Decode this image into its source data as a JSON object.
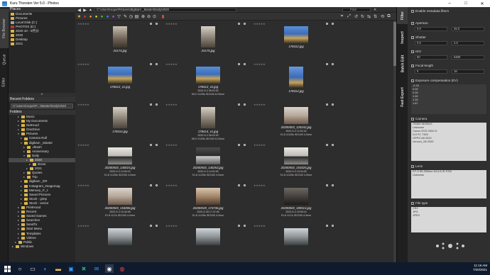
{
  "window": {
    "title": "Kuru Thorsten Ver 5.0 - Photos"
  },
  "left_tabs": [
    "File Browser",
    "Queue",
    "Editor"
  ],
  "places": {
    "header": "Places",
    "items": [
      {
        "label": "Documents",
        "icon": "folder"
      },
      {
        "label": "Pictures",
        "icon": "folder"
      },
      {
        "label": "Local Disk (C:)",
        "icon": "drive"
      },
      {
        "label": "PHOTOS (D:)",
        "icon": "drive-red"
      },
      {
        "label": "2020-10 - 9月分",
        "icon": "folder"
      },
      {
        "label": "2020",
        "icon": "folder"
      },
      {
        "label": "Desktop",
        "icon": "folder"
      },
      {
        "label": "2021",
        "icon": "folder"
      }
    ]
  },
  "recent_folders": {
    "header": "Recent Folders",
    "path": "C:\\Users\\reque\\Pi...\\Master\\Daily\\2020"
  },
  "folders": {
    "header": "Folders",
    "tree": [
      {
        "label": "Music",
        "indent": 3
      },
      {
        "label": "My Documents",
        "indent": 3
      },
      {
        "label": "NetHood",
        "indent": 3
      },
      {
        "label": "OneDrive",
        "indent": 3
      },
      {
        "label": "Pictures",
        "indent": 3,
        "expanded": true
      },
      {
        "label": "Camera Roll",
        "indent": 4
      },
      {
        "label": "digikam _Master",
        "indent": 4,
        "expanded": true
      },
      {
        "label": ".dtrash",
        "indent": 5
      },
      {
        "label": "Anniversary",
        "indent": 5
      },
      {
        "label": "Daily",
        "indent": 5,
        "expanded": true
      },
      {
        "label": "2020",
        "indent": 6,
        "selected": true
      },
      {
        "label": "drone",
        "indent": 7
      },
      {
        "label": "2021",
        "indent": 6
      },
      {
        "label": "Quotes",
        "indent": 5
      },
      {
        "label": "Trip",
        "indent": 5
      },
      {
        "label": "digikam _ER",
        "indent": 4
      },
      {
        "label": "Instagram_imagemag",
        "indent": 4
      },
      {
        "label": "Memory_P_J",
        "indent": 4
      },
      {
        "label": "Saved Pictures",
        "indent": 4
      },
      {
        "label": "Stock - gimp",
        "indent": 4
      },
      {
        "label": "Stock - vector",
        "indent": 4
      },
      {
        "label": "PrintHood",
        "indent": 3
      },
      {
        "label": "Recent",
        "indent": 3
      },
      {
        "label": "Saved Games",
        "indent": 3
      },
      {
        "label": "Searches",
        "indent": 3
      },
      {
        "label": "SendTo",
        "indent": 3
      },
      {
        "label": "Start Menu",
        "indent": 3
      },
      {
        "label": "Templates",
        "indent": 3
      },
      {
        "label": "Videos",
        "indent": 3
      },
      {
        "label": "Public",
        "indent": 2
      },
      {
        "label": "Windows",
        "indent": 1
      }
    ]
  },
  "toolbar": {
    "path": "C:\\Users\\reque\\Pictures\\digikam _Master\\Daily\\2020",
    "find_label": "Find"
  },
  "thumbnails": [
    {
      "name": "24174.jpg",
      "meta1": "",
      "meta2": "",
      "tone": "cityscape-portrait"
    },
    {
      "name": "24175.jpg",
      "meta1": "",
      "meta2": "",
      "tone": "street-portrait"
    },
    {
      "name": "178412.jpg",
      "meta1": "",
      "meta2": "",
      "tone": "blue-sky"
    },
    {
      "name": "178412_v1.jpg",
      "meta1": "",
      "meta2": "",
      "tone": "blue-sky"
    },
    {
      "name": "178412_v2.jpg",
      "meta1": "2020-5-2 08:02:00",
      "meta2": "f/8.0 1/125s ISO100 8.23mm",
      "tone": "blue-sky"
    },
    {
      "name": "178414.jpg",
      "meta1": "",
      "meta2": "",
      "tone": "blue-portrait"
    },
    {
      "name": "178414.jpg",
      "meta1": "",
      "meta2": "",
      "tone": "street-portrait"
    },
    {
      "name": "178414_v1.jpg",
      "meta1": "2020-5-2 08:02:00",
      "meta2": "f/8.0 1/125s ISO100 8.23mm",
      "tone": "street-portrait"
    },
    {
      "name": "20200503_125242.jpg",
      "meta1": "2020-5-3 12:52:42",
      "meta2": "f/1.8 1/125s ISO100 4.0mm",
      "tone": "indoor"
    },
    {
      "name": "20200503_140015.jpg",
      "meta1": "2020-5-3 14:00:15",
      "meta2": "f/1.8 1/125s ISO100 4.0mm",
      "tone": "laptop"
    },
    {
      "name": "20200503_140253.jpg",
      "meta1": "2020-5-3 14:02:53",
      "meta2": "f/1.8 1/125s ISO100 4.0mm",
      "tone": "laptop-dark"
    },
    {
      "name": "20200503_153425.jpg",
      "meta1": "2020-5-3 15:34:25",
      "meta2": "f/1.8 1/125s ISO100 4.0mm",
      "tone": "laptop"
    },
    {
      "name": "20200503_154008.jpg",
      "meta1": "2020-5-3 15:40:08",
      "meta2": "f/1.8 1/17s ISO100 4.0mm",
      "tone": "indoor"
    },
    {
      "name": "20200528_174736.jpg",
      "meta1": "2020-5-28 17:47:36",
      "meta2": "f/1.8 1/125s ISO100 4.0mm",
      "tone": "indoor-warm"
    },
    {
      "name": "20200603_185514.jpg",
      "meta1": "2020-6-3 18:55:14",
      "meta2": "f/1.8 1/17s ISO100 4.0mm",
      "tone": "indoor-dark"
    },
    {
      "name": "",
      "meta1": "",
      "meta2": "",
      "tone": "outdoor"
    },
    {
      "name": "",
      "meta1": "",
      "meta2": "",
      "tone": "outdoor"
    },
    {
      "name": "",
      "meta1": "",
      "meta2": "",
      "tone": "outdoor"
    }
  ],
  "right_tabs": [
    "Filter",
    "Inspect",
    "Batch Edit",
    "Fast Export"
  ],
  "filter": {
    "enable_label": "Enable metadata filters",
    "aperture": {
      "label": "Aperture",
      "from": "0.0",
      "to": "25.0"
    },
    "shutter": {
      "label": "Shutter",
      "from": "0.0",
      "to": "2.0"
    },
    "iso": {
      "label": "ISO",
      "from": "50",
      "to": "6400"
    },
    "focal": {
      "label": "Focal length",
      "from": "0",
      "to": "16"
    },
    "exposure": {
      "label": "Exposure compensation (EV)",
      "items": [
        "-0.33",
        "0.00",
        "0.33",
        "1.00",
        "1.33",
        "1.67"
      ]
    },
    "camera": {
      "label": "Camera",
      "items": [
        "OSMO MOBILE",
        "Unknown",
        "Canon EOS 2000 D",
        "DJI FC 7303",
        "OPPO A5 2020",
        "Lenovo_1B 2020"
      ]
    },
    "lens": {
      "label": "Lens",
      "items": [
        "EF-S 55-250mm f/4-5.6 IS STM",
        "Unknown"
      ]
    },
    "filetype": {
      "label": "File type",
      "items": [
        "CR2",
        "JPG",
        "JPEG"
      ]
    }
  },
  "taskbar": {
    "time": "11:16 AM",
    "date": "7/20/2021"
  }
}
